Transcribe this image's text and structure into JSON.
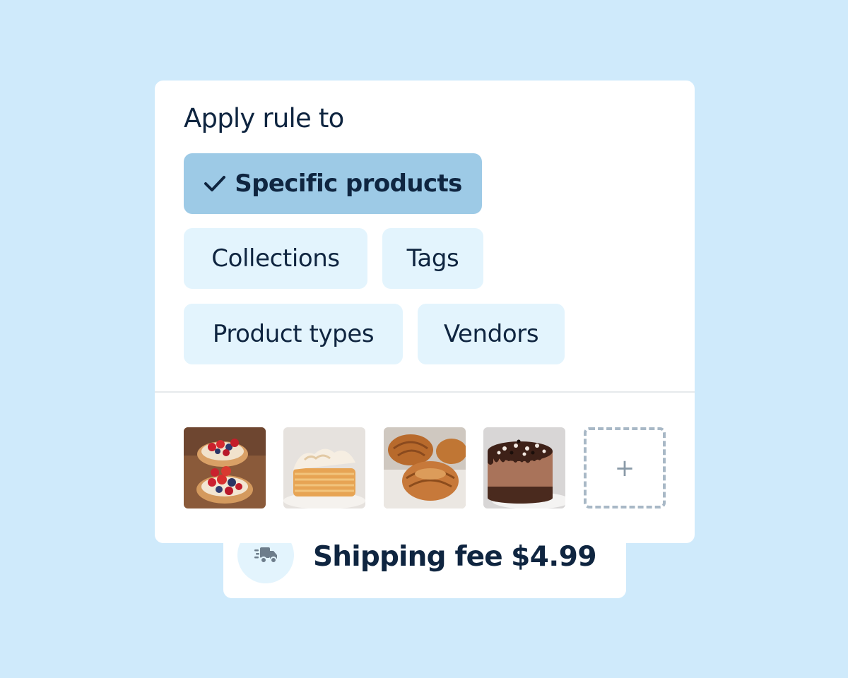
{
  "rule": {
    "title": "Apply rule to",
    "options": [
      {
        "label": "Specific products",
        "selected": true
      },
      {
        "label": "Collections",
        "selected": false
      },
      {
        "label": "Tags",
        "selected": false
      },
      {
        "label": "Product types",
        "selected": false
      },
      {
        "label": "Vendors",
        "selected": false
      }
    ],
    "products": [
      {
        "name": "fruit-tartlets",
        "icon": "fruit-tart-image"
      },
      {
        "name": "lemon-meringue-pastry",
        "icon": "meringue-pastry-image"
      },
      {
        "name": "croissants",
        "icon": "croissant-image"
      },
      {
        "name": "chocolate-cake",
        "icon": "chocolate-cake-image"
      }
    ],
    "add_label": "+"
  },
  "shipping": {
    "icon": "delivery-truck-icon",
    "label": "Shipping fee",
    "price": "$4.99"
  },
  "colors": {
    "background": "#cfeafb",
    "chip": "#e3f4fd",
    "chip_selected": "#9dcae6",
    "text": "#0f2540"
  }
}
